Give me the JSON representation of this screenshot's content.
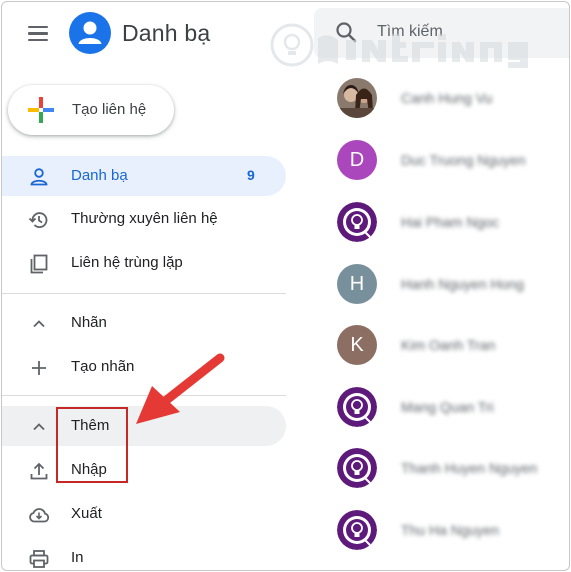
{
  "header": {
    "menu_icon": "hamburger-menu-icon",
    "app_icon": "contacts-person-icon",
    "app_title": "Danh bạ",
    "search_icon": "search-icon",
    "search_placeholder": "Tìm kiếm",
    "accent_color": "#1a73e8"
  },
  "create_button": {
    "icon": "plus-colored-icon",
    "label": "Tạo liên hệ"
  },
  "sidebar": {
    "items": [
      {
        "icon": "person-icon",
        "label": "Danh bạ",
        "count": "9",
        "active": true
      },
      {
        "icon": "history-icon",
        "label": "Thường xuyên liên hệ"
      },
      {
        "icon": "copy-icon",
        "label": "Liên hệ trùng lặp"
      }
    ],
    "labels_section": {
      "icon": "chevron-up-icon",
      "label": "Nhãn"
    },
    "create_label": {
      "icon": "plus-icon",
      "label": "Tạo nhãn"
    },
    "more_section": {
      "icon": "chevron-up-icon",
      "label": "Thêm"
    },
    "more_items": [
      {
        "icon": "upload-icon",
        "label": "Nhập"
      },
      {
        "icon": "cloud-download-icon",
        "label": "Xuất"
      },
      {
        "icon": "print-icon",
        "label": "In"
      }
    ]
  },
  "contacts": [
    {
      "name": "Canh Hung Vu",
      "avatar": "photo",
      "color": "#6d4c41"
    },
    {
      "name": "Duc Truong Nguyen",
      "avatar": "letter",
      "letter": "D",
      "color": "#ab47bc"
    },
    {
      "name": "Hai Pham Ngoc",
      "avatar": "logo",
      "color": "#5e1a7a"
    },
    {
      "name": "Hanh Nguyen Hong",
      "avatar": "letter",
      "letter": "H",
      "color": "#78909c"
    },
    {
      "name": "Kim Oanh Tran",
      "avatar": "letter",
      "letter": "K",
      "color": "#8d6e63"
    },
    {
      "name": "Mang Quan Tri",
      "avatar": "logo",
      "color": "#5e1a7a"
    },
    {
      "name": "Thanh Huyen Nguyen",
      "avatar": "logo",
      "color": "#5e1a7a"
    },
    {
      "name": "Thu Ha Nguyen",
      "avatar": "logo",
      "color": "#5e1a7a"
    }
  ],
  "annotation": {
    "highlight_color": "#c62828",
    "arrow_color": "#e53935"
  }
}
